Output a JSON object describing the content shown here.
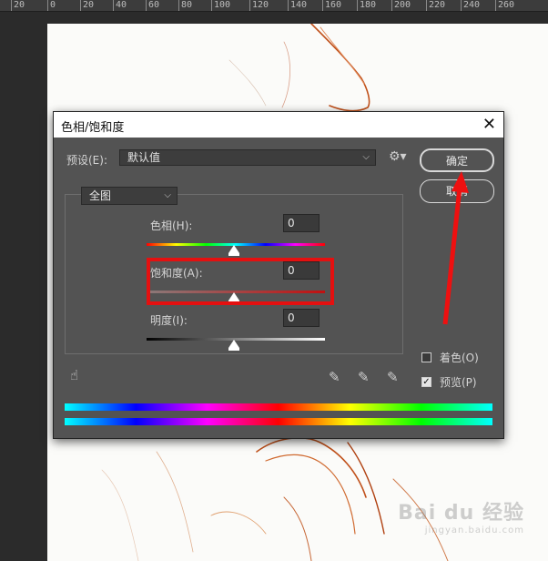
{
  "ruler": {
    "ticks": [
      "20",
      "0",
      "20",
      "40",
      "60",
      "80",
      "100",
      "120",
      "140",
      "160",
      "180",
      "200",
      "220",
      "240",
      "260"
    ]
  },
  "dialog": {
    "title": "色相/饱和度",
    "preset_label": "预设(E):",
    "preset_value": "默认值",
    "ok_label": "确定",
    "cancel_label": "取消",
    "channel_value": "全图",
    "hue": {
      "label": "色相(H):",
      "value": "0"
    },
    "saturation": {
      "label": "饱和度(A):",
      "value": "0"
    },
    "lightness": {
      "label": "明度(I):",
      "value": "0"
    },
    "colorize_label": "着色(O)",
    "colorize_checked": false,
    "preview_label": "预览(P)",
    "preview_checked": true
  },
  "watermark": {
    "text": "Bai du 经验",
    "sub": "jingyan.baidu.com"
  },
  "colors": {
    "highlight": "#e41010",
    "arrow": "#ee1010",
    "dialog_bg": "#535353"
  }
}
